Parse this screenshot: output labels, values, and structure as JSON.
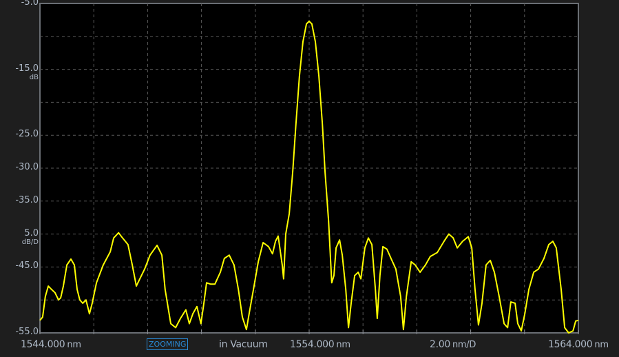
{
  "chart_data": {
    "type": "line",
    "xlim": [
      1544.0,
      1564.0
    ],
    "ylim": [
      -55.0,
      -5.0
    ],
    "grid": true,
    "grid_style": "dashed",
    "trace_color": "#ffff00",
    "background_color": "#000000",
    "y_ticks": [
      {
        "value": -5.0,
        "label": "-5.0",
        "unit": ""
      },
      {
        "value": -15.0,
        "label": "-15.0",
        "unit": "dB"
      },
      {
        "value": -25.0,
        "label": "-25.0",
        "unit": ""
      },
      {
        "value": -30.0,
        "label": "-30.0",
        "unit": ""
      },
      {
        "value": -35.0,
        "label": "-35.0",
        "unit": ""
      },
      {
        "value": -40.0,
        "label": "5.0",
        "unit": "dB/D"
      },
      {
        "value": -45.0,
        "label": "-45.0",
        "unit": ""
      },
      {
        "value": -55.0,
        "label": "-55.0",
        "unit": ""
      }
    ],
    "x_labels": {
      "start": {
        "value": "1544.000",
        "unit": "nm"
      },
      "center": {
        "value": "1554.000",
        "unit": "nm"
      },
      "span_per_div": {
        "value": "2.00",
        "unit": "nm/D"
      },
      "stop": {
        "value": "1564.000",
        "unit": "nm"
      }
    },
    "series": [
      {
        "x": [
          1544.0,
          1544.1,
          1544.2,
          1544.31,
          1544.43,
          1544.56,
          1544.69,
          1544.77,
          1544.87,
          1545.0,
          1545.15,
          1545.28,
          1545.38,
          1545.48,
          1545.59,
          1545.71,
          1545.84,
          1545.94,
          1546.1,
          1546.35,
          1546.61,
          1546.74,
          1546.92,
          1547.07,
          1547.27,
          1547.43,
          1547.58,
          1547.71,
          1547.89,
          1548.09,
          1548.35,
          1548.53,
          1548.65,
          1548.86,
          1549.04,
          1549.22,
          1549.42,
          1549.55,
          1549.68,
          1549.83,
          1549.98,
          1550.09,
          1550.19,
          1550.34,
          1550.5,
          1550.7,
          1550.85,
          1551.03,
          1551.21,
          1551.37,
          1551.52,
          1551.67,
          1551.77,
          1551.93,
          1552.11,
          1552.29,
          1552.49,
          1552.64,
          1552.75,
          1552.85,
          1553.0,
          1553.05,
          1553.13,
          1553.26,
          1553.39,
          1553.51,
          1553.64,
          1553.77,
          1553.9,
          1554.0,
          1554.1,
          1554.23,
          1554.36,
          1554.49,
          1554.59,
          1554.72,
          1554.84,
          1554.92,
          1555.0,
          1555.13,
          1555.23,
          1555.36,
          1555.46,
          1555.56,
          1555.69,
          1555.82,
          1555.92,
          1556.07,
          1556.2,
          1556.33,
          1556.46,
          1556.53,
          1556.63,
          1556.74,
          1556.89,
          1557.04,
          1557.22,
          1557.4,
          1557.5,
          1557.61,
          1557.79,
          1557.94,
          1558.12,
          1558.32,
          1558.5,
          1558.76,
          1559.01,
          1559.19,
          1559.35,
          1559.5,
          1559.7,
          1559.91,
          1560.04,
          1560.16,
          1560.29,
          1560.42,
          1560.57,
          1560.73,
          1560.88,
          1561.06,
          1561.24,
          1561.37,
          1561.49,
          1561.65,
          1561.75,
          1561.88,
          1562.01,
          1562.16,
          1562.34,
          1562.52,
          1562.72,
          1562.9,
          1563.05,
          1563.18,
          1563.36,
          1563.49,
          1563.64,
          1563.8,
          1563.9,
          1564.0
        ],
        "y": [
          -53.1,
          -52.6,
          -49.5,
          -47.9,
          -48.4,
          -48.9,
          -50.0,
          -49.7,
          -47.9,
          -44.7,
          -43.8,
          -44.7,
          -48.4,
          -50.0,
          -50.5,
          -50.0,
          -52.1,
          -50.5,
          -47.4,
          -44.7,
          -42.7,
          -40.6,
          -39.8,
          -40.6,
          -41.6,
          -44.7,
          -47.9,
          -46.8,
          -45.3,
          -43.2,
          -41.7,
          -43.2,
          -48.4,
          -53.6,
          -54.2,
          -52.8,
          -51.5,
          -53.6,
          -52.1,
          -51.0,
          -53.6,
          -50.5,
          -47.4,
          -47.6,
          -47.6,
          -45.8,
          -43.7,
          -43.2,
          -44.7,
          -48.4,
          -52.6,
          -54.5,
          -52.1,
          -48.4,
          -44.2,
          -41.3,
          -41.9,
          -43.0,
          -41.1,
          -40.3,
          -44.7,
          -46.8,
          -40.0,
          -36.9,
          -30.6,
          -23.3,
          -16.0,
          -10.8,
          -8.1,
          -7.7,
          -8.1,
          -10.8,
          -16.0,
          -23.3,
          -30.6,
          -38.0,
          -47.4,
          -46.3,
          -42.1,
          -40.9,
          -43.2,
          -48.4,
          -54.2,
          -50.5,
          -46.3,
          -45.8,
          -46.8,
          -42.1,
          -40.6,
          -41.6,
          -48.4,
          -52.8,
          -46.3,
          -41.9,
          -42.3,
          -43.7,
          -45.3,
          -49.5,
          -54.5,
          -49.5,
          -44.2,
          -44.7,
          -45.8,
          -44.7,
          -43.4,
          -42.8,
          -41.1,
          -40.0,
          -40.6,
          -42.1,
          -41.1,
          -40.4,
          -42.1,
          -48.4,
          -53.8,
          -50.5,
          -44.7,
          -44.0,
          -45.8,
          -49.5,
          -53.6,
          -54.2,
          -50.3,
          -50.5,
          -53.6,
          -54.7,
          -52.1,
          -48.4,
          -45.8,
          -45.3,
          -43.7,
          -41.6,
          -41.1,
          -42.1,
          -48.4,
          -54.2,
          -55.0,
          -54.7,
          -53.2,
          -53.1
        ]
      }
    ]
  },
  "status": {
    "zooming": "ZOOMING",
    "medium": "in Vacuum"
  }
}
